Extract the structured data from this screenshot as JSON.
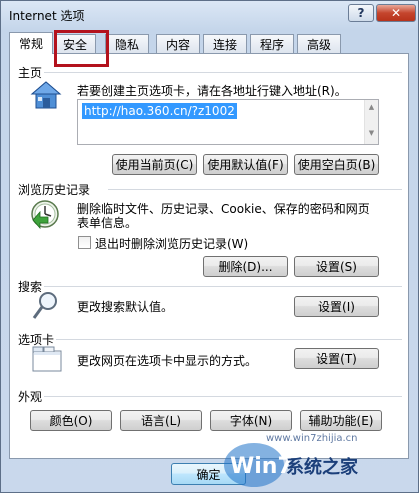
{
  "window": {
    "title": "Internet 选项",
    "help_label": "?",
    "close_label": "✕"
  },
  "tabs": [
    {
      "label": "常规",
      "active": true
    },
    {
      "label": "安全",
      "active": false
    },
    {
      "label": "隐私",
      "active": false
    },
    {
      "label": "内容",
      "active": false
    },
    {
      "label": "连接",
      "active": false
    },
    {
      "label": "程序",
      "active": false
    },
    {
      "label": "高级",
      "active": false
    }
  ],
  "home": {
    "heading": "主页",
    "instruction": "若要创建主页选项卡，请在各地址行键入地址(R)。",
    "url": "http://hao.360.cn/?z1002",
    "use_current": "使用当前页(C)",
    "use_default": "使用默认值(F)",
    "use_blank": "使用空白页(B)"
  },
  "history": {
    "heading": "浏览历史记录",
    "description_line1": "删除临时文件、历史记录、Cookie、保存的密码和网页",
    "description_line2": "表单信息。",
    "checkbox_label": "退出时删除浏览历史记录(W)",
    "delete_label": "删除(D)...",
    "settings_label": "设置(S)"
  },
  "search": {
    "heading": "搜索",
    "description": "更改搜索默认值。",
    "settings_label": "设置(I)"
  },
  "tabs_section": {
    "heading": "选项卡",
    "description": "更改网页在选项卡中显示的方式。",
    "settings_label": "设置(T)"
  },
  "appearance": {
    "heading": "外观",
    "colors_label": "颜色(O)",
    "languages_label": "语言(L)",
    "fonts_label": "字体(N)",
    "accessibility_label": "辅助功能(E)"
  },
  "footer": {
    "ok_label": "确定"
  },
  "watermark": {
    "text1": "Win7",
    "text2": "系统之家",
    "text3": "www.win7zhijia.cn"
  },
  "colors": {
    "highlight_box": "#b3121d",
    "selection": "#3399ff"
  }
}
